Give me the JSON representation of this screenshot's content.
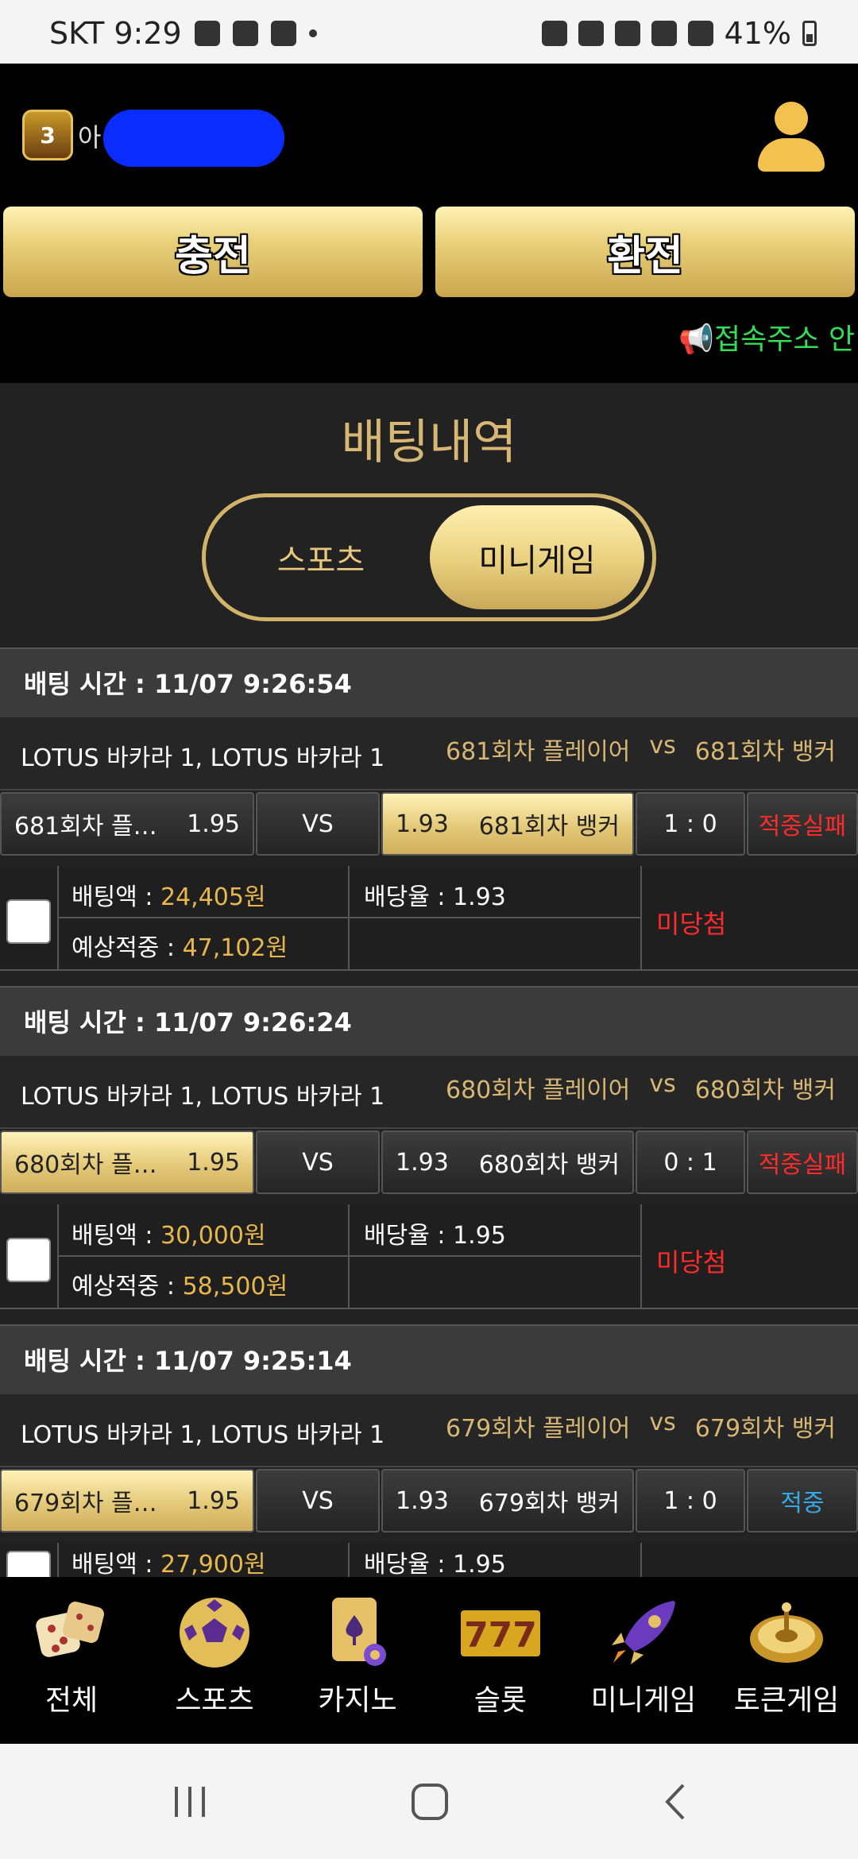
{
  "status_bar": {
    "carrier_time": "SKT 9:29",
    "battery": "41%",
    "icons": [
      "image-icon",
      "game-controller-icon",
      "play-store-icon",
      "dot-icon",
      "alarm-icon",
      "mute-icon",
      "location-icon",
      "5g-icon",
      "signal-icon",
      "battery-icon"
    ]
  },
  "header": {
    "level": "3",
    "user_name": "아",
    "deposit_label": "충전",
    "withdraw_label": "환전",
    "notice": "접속주소 안"
  },
  "page": {
    "title": "배팅내역",
    "tabs": [
      {
        "label": "스포츠",
        "active": false
      },
      {
        "label": "미니게임",
        "active": true
      }
    ]
  },
  "bets": [
    {
      "time_label": "배팅 시간 : 11/07 9:26:54",
      "game": "LOTUS 바카라 1, LOTUS 바카라 1",
      "home": "681회차 플레이어",
      "vs": "vs",
      "away": "681회차 뱅커",
      "home_short": "681회차 플레…",
      "home_odds": "1.95",
      "vs_label": "VS",
      "away_odds": "1.93",
      "away_short": "681회차 뱅커",
      "selected": "away",
      "score": "1 : 0",
      "result": "적중실패",
      "result_type": "lost",
      "bet_amount_label": "배팅액 : ",
      "bet_amount": "24,405원",
      "odds_label": "배당율 : ",
      "odds": "1.93",
      "expected_label": "예상적중 : ",
      "expected": "47,102원",
      "status": "미당첨"
    },
    {
      "time_label": "배팅 시간 : 11/07 9:26:24",
      "game": "LOTUS 바카라 1, LOTUS 바카라 1",
      "home": "680회차 플레이어",
      "vs": "vs",
      "away": "680회차 뱅커",
      "home_short": "680회차 플레…",
      "home_odds": "1.95",
      "vs_label": "VS",
      "away_odds": "1.93",
      "away_short": "680회차 뱅커",
      "selected": "home",
      "score": "0 : 1",
      "result": "적중실패",
      "result_type": "lost",
      "bet_amount_label": "배팅액 : ",
      "bet_amount": "30,000원",
      "odds_label": "배당율 : ",
      "odds": "1.95",
      "expected_label": "예상적중 : ",
      "expected": "58,500원",
      "status": "미당첨"
    },
    {
      "time_label": "배팅 시간 : 11/07 9:25:14",
      "game": "LOTUS 바카라 1, LOTUS 바카라 1",
      "home": "679회차 플레이어",
      "vs": "vs",
      "away": "679회차 뱅커",
      "home_short": "679회차 플레…",
      "home_odds": "1.95",
      "vs_label": "VS",
      "away_odds": "1.93",
      "away_short": "679회차 뱅커",
      "selected": "home",
      "score": "1 : 0",
      "result": "적중",
      "result_type": "won",
      "bet_amount_label": "배팅액 : ",
      "bet_amount": "27,900원",
      "odds_label": "배당율 : ",
      "odds": "1.95",
      "expected_label": "",
      "expected": "",
      "status": ""
    }
  ],
  "bottom_nav": [
    {
      "label": "전체",
      "icon": "dice-icon"
    },
    {
      "label": "스포츠",
      "icon": "soccer-ball-icon"
    },
    {
      "label": "카지노",
      "icon": "cards-icon"
    },
    {
      "label": "슬롯",
      "icon": "slot-777-icon"
    },
    {
      "label": "미니게임",
      "icon": "rocket-icon"
    },
    {
      "label": "토큰게임",
      "icon": "roulette-icon"
    }
  ],
  "colors": {
    "gold": "#d8b774",
    "lost": "#ff2b2b",
    "won": "#37a8e6",
    "notice": "#33dd55"
  }
}
